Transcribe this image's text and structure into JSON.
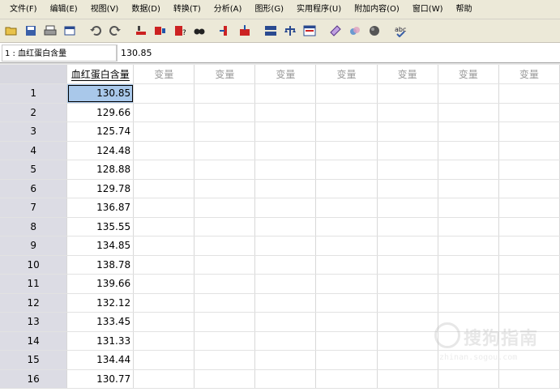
{
  "menu": [
    "文件(F)",
    "编辑(E)",
    "视图(V)",
    "数据(D)",
    "转换(T)",
    "分析(A)",
    "图形(G)",
    "实用程序(U)",
    "附加内容(O)",
    "窗口(W)",
    "帮助"
  ],
  "toolbar": {
    "icons": [
      "open-folder-icon",
      "save-icon",
      "print-icon",
      "dialog-recall-icon",
      "undo-icon",
      "redo-icon",
      "goto-case-icon",
      "goto-variable-icon",
      "variables-icon",
      "find-icon",
      "insert-case-icon",
      "insert-variable-icon",
      "split-file-icon",
      "weight-cases-icon",
      "select-cases-icon",
      "value-labels-icon",
      "use-sets-icon",
      "show-all-variables-icon",
      "spelling-icon"
    ]
  },
  "cell_editor": {
    "reference": "1 : 血红蛋白含量",
    "value": "130.85"
  },
  "grid": {
    "named_column": "血红蛋白含量",
    "empty_column_label": "变量",
    "empty_column_count": 7,
    "rows": [
      {
        "n": "1",
        "v": "130.85"
      },
      {
        "n": "2",
        "v": "129.66"
      },
      {
        "n": "3",
        "v": "125.74"
      },
      {
        "n": "4",
        "v": "124.48"
      },
      {
        "n": "5",
        "v": "128.88"
      },
      {
        "n": "6",
        "v": "129.78"
      },
      {
        "n": "7",
        "v": "136.87"
      },
      {
        "n": "8",
        "v": "135.55"
      },
      {
        "n": "9",
        "v": "134.85"
      },
      {
        "n": "10",
        "v": "138.78"
      },
      {
        "n": "11",
        "v": "139.66"
      },
      {
        "n": "12",
        "v": "132.12"
      },
      {
        "n": "13",
        "v": "133.45"
      },
      {
        "n": "14",
        "v": "131.33"
      },
      {
        "n": "15",
        "v": "134.44"
      },
      {
        "n": "16",
        "v": "130.77"
      }
    ],
    "selected_row": 0
  },
  "watermark": {
    "text": "搜狗指南",
    "subtext": "zhinan.sogou.com"
  }
}
